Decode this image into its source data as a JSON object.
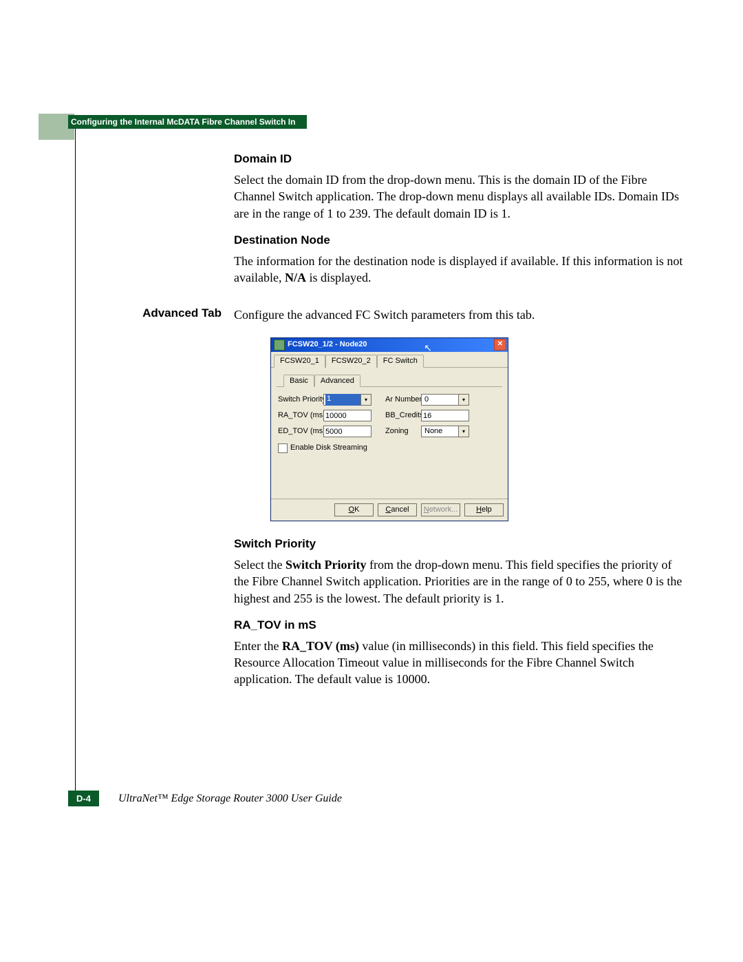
{
  "header_bar": "Configuring the Internal McDATA Fibre Channel Switch In",
  "sections": {
    "domain_id": {
      "title": "Domain ID",
      "body": "Select the domain ID from the drop-down menu. This is the domain ID of the Fibre Channel Switch application. The drop-down menu displays all available IDs. Domain IDs are in the range of 1 to 239. The default domain ID is 1."
    },
    "destination_node": {
      "title": "Destination Node",
      "body_pre": "The information for the destination node is displayed if available. If this information is not available, ",
      "body_bold": "N/A",
      "body_post": " is displayed."
    },
    "advanced_tab": {
      "side_label": "Advanced Tab",
      "body": "Configure the advanced FC Switch parameters from this tab."
    },
    "switch_priority": {
      "title": "Switch Priority",
      "body_pre": "Select the ",
      "body_bold": "Switch Priority",
      "body_post": " from the drop-down menu. This field specifies the priority of the Fibre Channel Switch application. Priorities are in the range of 0 to 255, where 0 is the highest and 255 is the lowest. The default priority is 1."
    },
    "ra_tov": {
      "title": "RA_TOV in mS",
      "body_pre": "Enter the ",
      "body_bold": "RA_TOV (ms)",
      "body_post": " value (in milliseconds) in this field. This field specifies the Resource Allocation Timeout value in milliseconds for the Fibre Channel Switch application. The default value is 10000."
    }
  },
  "dialog": {
    "title": "FCSW20_1/2 - Node20",
    "tabs1": [
      "FCSW20_1",
      "FCSW20_2",
      "FC Switch"
    ],
    "tabs1_active": 2,
    "tabs2": [
      "Basic",
      "Advanced"
    ],
    "tabs2_active": 1,
    "fields": {
      "switch_priority": {
        "label": "Switch Priority",
        "value": "1"
      },
      "ar_number": {
        "label": "Ar Number",
        "value": "0"
      },
      "ra_tov": {
        "label": "RA_TOV (ms):",
        "value": "10000"
      },
      "bb_credits": {
        "label": "BB_Credits:",
        "value": "16"
      },
      "ed_tov": {
        "label": "ED_TOV (ms):",
        "value": "5000"
      },
      "zoning": {
        "label": "Zoning",
        "value": "None"
      },
      "enable_disk_streaming": "Enable Disk Streaming"
    },
    "buttons": {
      "ok": "OK",
      "cancel": "Cancel",
      "network": "Network...",
      "help": "Help"
    }
  },
  "footer": {
    "page_num": "D-4",
    "guide_title": "UltraNet™ Edge Storage Router 3000 User Guide"
  }
}
